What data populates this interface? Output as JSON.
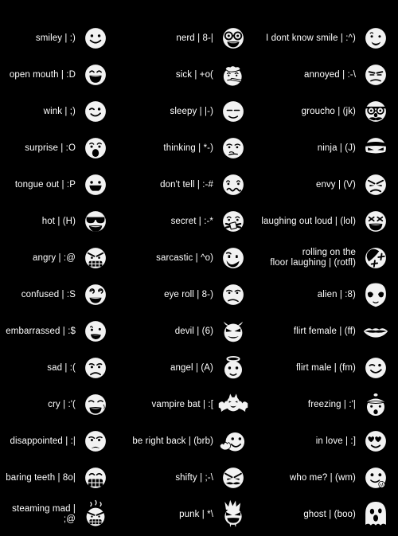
{
  "page": {
    "title": "Emoticon reference sheet",
    "background_color": "#000000",
    "text_color": "#ffffff"
  },
  "columns": [
    {
      "name": "column-1",
      "items": [
        {
          "label": "smiley",
          "code": ":)",
          "icon": "smiley-icon"
        },
        {
          "label": "open mouth",
          "code": ":D",
          "icon": "open-mouth-icon"
        },
        {
          "label": "wink",
          "code": ";)",
          "icon": "wink-icon"
        },
        {
          "label": "surprise",
          "code": ":O",
          "icon": "surprise-icon"
        },
        {
          "label": "tongue out",
          "code": ":P",
          "icon": "tongue-out-icon"
        },
        {
          "label": "hot",
          "code": "(H)",
          "icon": "hot-sunglasses-icon"
        },
        {
          "label": "angry",
          "code": ":@",
          "icon": "angry-icon"
        },
        {
          "label": "confused",
          "code": ":S",
          "icon": "confused-icon"
        },
        {
          "label": "embarrassed",
          "code": ":$",
          "icon": "embarrassed-icon"
        },
        {
          "label": "sad",
          "code": ":(",
          "icon": "sad-icon"
        },
        {
          "label": "cry",
          "code": ":'(",
          "icon": "cry-icon"
        },
        {
          "label": "disappointed",
          "code": ":|",
          "icon": "disappointed-icon"
        },
        {
          "label": "baring teeth",
          "code": "8o|",
          "icon": "baring-teeth-icon"
        },
        {
          "label": "steaming mad",
          "code": ";@",
          "icon": "steaming-mad-icon"
        }
      ]
    },
    {
      "name": "column-2",
      "items": [
        {
          "label": "nerd",
          "code": "8-|",
          "icon": "nerd-icon"
        },
        {
          "label": "sick",
          "code": "+o(",
          "icon": "sick-icon"
        },
        {
          "label": "sleepy",
          "code": "|-)",
          "icon": "sleepy-icon"
        },
        {
          "label": "thinking",
          "code": "*-)",
          "icon": "thinking-icon"
        },
        {
          "label": "don't tell",
          "code": ":-#",
          "icon": "dont-tell-icon"
        },
        {
          "label": "secret",
          "code": ":-*",
          "icon": "secret-icon"
        },
        {
          "label": "sarcastic",
          "code": "^o)",
          "icon": "sarcastic-icon"
        },
        {
          "label": "eye roll",
          "code": "8-)",
          "icon": "eye-roll-icon"
        },
        {
          "label": "devil",
          "code": "(6)",
          "icon": "devil-icon"
        },
        {
          "label": "angel",
          "code": "(A)",
          "icon": "angel-icon"
        },
        {
          "label": "vampire bat",
          "code": ":[",
          "icon": "vampire-bat-icon"
        },
        {
          "label": "be right back",
          "code": "(brb)",
          "icon": "be-right-back-icon"
        },
        {
          "label": "shifty",
          "code": ";-\\",
          "icon": "shifty-icon"
        },
        {
          "label": "punk",
          "code": "*\\",
          "icon": "punk-icon"
        }
      ]
    },
    {
      "name": "column-3",
      "items": [
        {
          "label": "I dont know smile",
          "code": ":^)",
          "icon": "dont-know-smile-icon"
        },
        {
          "label": "annoyed",
          "code": ":-\\",
          "icon": "annoyed-icon"
        },
        {
          "label": "groucho",
          "code": "(jk)",
          "icon": "groucho-icon"
        },
        {
          "label": "ninja",
          "code": "(J)",
          "icon": "ninja-icon"
        },
        {
          "label": "envy",
          "code": "(V)",
          "icon": "envy-icon"
        },
        {
          "label": "laughing out loud",
          "code": "(lol)",
          "icon": "laughing-out-loud-icon"
        },
        {
          "label": "rolling on the\nfloor laughing",
          "code": "(rotfl)",
          "icon": "rotfl-icon"
        },
        {
          "label": "alien",
          "code": ":8)",
          "icon": "alien-icon"
        },
        {
          "label": "flirt female",
          "code": "(ff)",
          "icon": "flirt-female-lips-icon"
        },
        {
          "label": "flirt male",
          "code": "(fm)",
          "icon": "flirt-male-icon"
        },
        {
          "label": "freezing",
          "code": ":'|",
          "icon": "freezing-icon"
        },
        {
          "label": "in love",
          "code": ":]",
          "icon": "in-love-icon"
        },
        {
          "label": "who me?",
          "code": "(wm)",
          "icon": "who-me-icon"
        },
        {
          "label": "ghost",
          "code": "(boo)",
          "icon": "ghost-icon"
        }
      ]
    }
  ]
}
